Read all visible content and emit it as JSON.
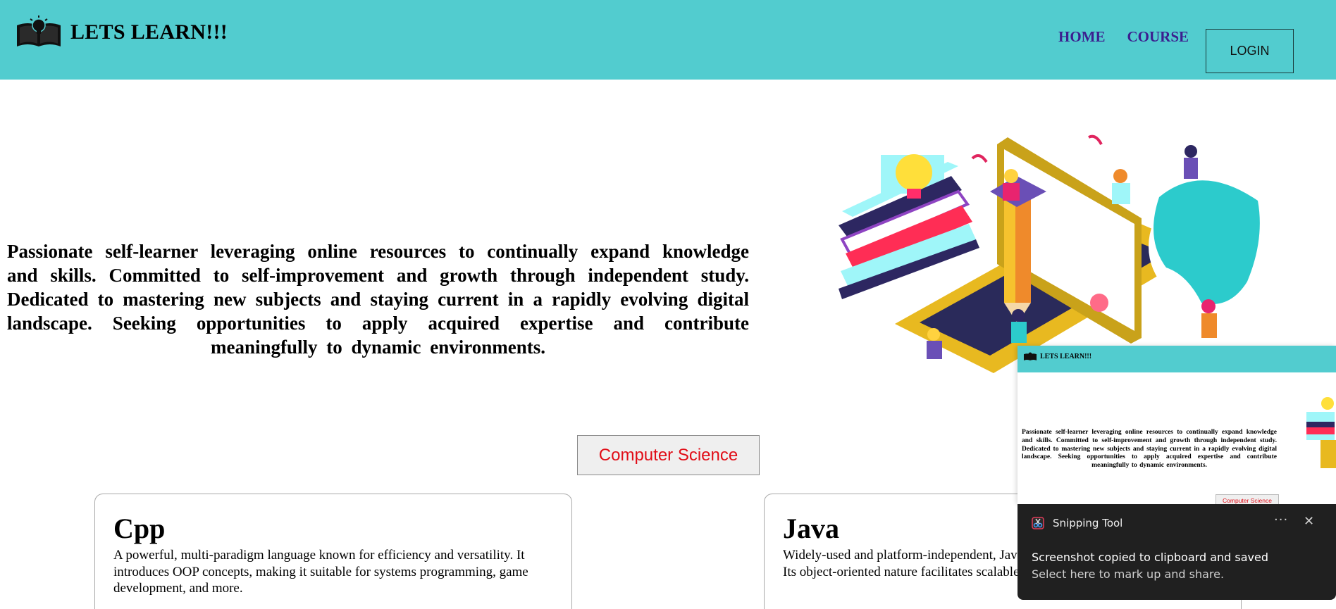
{
  "header": {
    "brand": "LETS LEARN!!!",
    "brand_icon": "book-bulb-icon",
    "nav": [
      {
        "label": "HOME"
      },
      {
        "label": "COURSE"
      }
    ],
    "login_label": "LOGIN",
    "colors": {
      "background": "#52cccf",
      "nav_link": "#3c1f8f"
    }
  },
  "hero": {
    "text": "Passionate self-learner leveraging online resources to continually expand knowledge and skills. Committed to self-improvement and growth through independent study. Dedicated to mastering new subjects and staying current in a rapidly evolving digital landscape. Seeking opportunities to apply acquired expertise and contribute meaningfully to dynamic environments.",
    "illustration": "online-learning-illustration"
  },
  "category": {
    "label": "Computer Science",
    "color": "#e10d17"
  },
  "cards": [
    {
      "title": "Cpp",
      "description": "A powerful, multi-paradigm language known for efficiency and versatility. It introduces OOP concepts, making it suitable for systems programming, game development, and more."
    },
    {
      "title": "Java",
      "description": "Widely-used and platform-independent, Java is ideal for enterprise applications. Its object-oriented nature facilitates scalable and secure software development."
    }
  ],
  "snip_preview": {
    "brand": "LETS LEARN!!!",
    "text": "Passionate self-learner leveraging online resources to continually expand knowledge and skills. Committed to self-improvement and growth through independent study. Dedicated to mastering new subjects and staying current in a rapidly evolving digital landscape. Seeking opportunities to apply acquired expertise and contribute meaningfully to dynamic environments.",
    "button": "Computer Science"
  },
  "toast": {
    "app_name": "Snipping Tool",
    "app_icon": "snipping-tool-icon",
    "more": "···",
    "close": "✕",
    "title": "Screenshot copied to clipboard and saved",
    "subtitle": "Select here to mark up and share."
  }
}
